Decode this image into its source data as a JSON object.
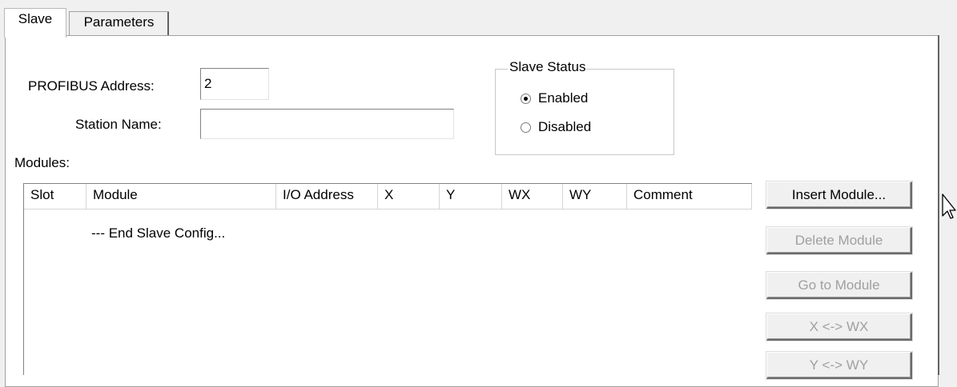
{
  "tabs": [
    {
      "label": "Slave",
      "active": true
    },
    {
      "label": "Parameters",
      "active": false
    }
  ],
  "form": {
    "profibus_address_label": "PROFIBUS Address:",
    "profibus_address_value": "2",
    "station_name_label": "Station Name:",
    "station_name_value": ""
  },
  "slave_status": {
    "title": "Slave Status",
    "options": [
      {
        "label": "Enabled",
        "checked": true
      },
      {
        "label": "Disabled",
        "checked": false
      }
    ]
  },
  "modules": {
    "label": "Modules:",
    "columns": [
      "Slot",
      "Module",
      "I/O Address",
      "X",
      "Y",
      "WX",
      "WY",
      "Comment"
    ],
    "rows": [
      {
        "slot": "",
        "module": "--- End Slave Config...",
        "io_address": "",
        "x": "",
        "y": "",
        "wx": "",
        "wy": "",
        "comment": ""
      }
    ]
  },
  "buttons": [
    {
      "label": "Insert Module...",
      "enabled": true
    },
    {
      "label": "Delete Module",
      "enabled": false
    },
    {
      "label": "Go to Module",
      "enabled": false
    },
    {
      "label": "X <-> WX",
      "enabled": false
    },
    {
      "label": "Y <-> WY",
      "enabled": false
    }
  ],
  "colors": {
    "panel": "#ffffff",
    "dialog": "#f0f0f0",
    "disabled_text": "#a0a0a0"
  },
  "icons": {
    "cursor": "arrow-cursor-icon"
  }
}
